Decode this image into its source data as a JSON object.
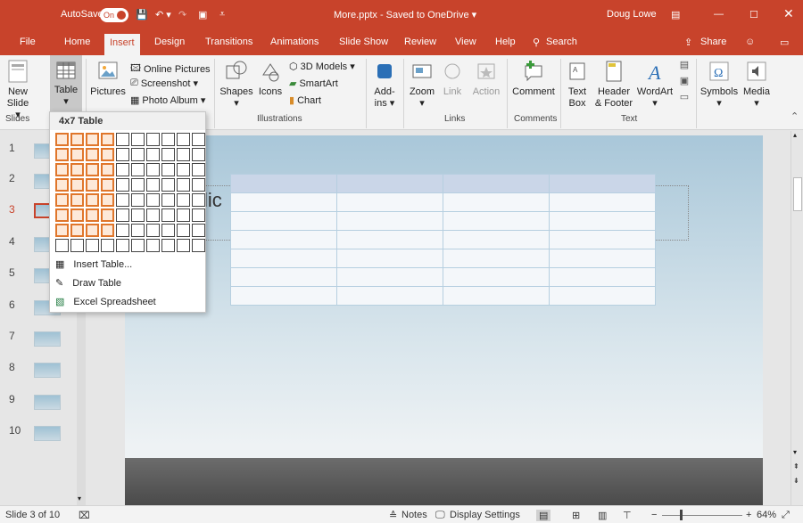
{
  "title_bar": {
    "autosave_label": "AutoSave",
    "autosave_state": "On",
    "document_title": "More.pptx - Saved to OneDrive ▾",
    "user_name": "Doug Lowe"
  },
  "tabs": [
    "File",
    "Home",
    "Insert",
    "Design",
    "Transitions",
    "Animations",
    "Slide Show",
    "Review",
    "View",
    "Help"
  ],
  "active_tab": "Insert",
  "search_label": "Search",
  "share_label": "Share",
  "ribbon": {
    "slides": {
      "new_slide": "New",
      "new_slide2": "Slide ▾",
      "group": "Slides"
    },
    "tables": {
      "table": "Table",
      "table_arrow": "▾"
    },
    "images": {
      "pictures": "Pictures",
      "online_pictures": "Online Pictures",
      "screenshot": "Screenshot ▾",
      "photo_album": "Photo Album ▾"
    },
    "illustrations": {
      "shapes": "Shapes",
      "icons": "Icons",
      "models": "3D Models ▾",
      "smartart": "SmartArt",
      "chart": "Chart",
      "group": "Illustrations"
    },
    "addins": {
      "label": "Add-",
      "label2": "ins ▾"
    },
    "links": {
      "zoom": "Zoom",
      "link": "Link",
      "action": "Action",
      "group": "Links"
    },
    "comments": {
      "comment": "Comment",
      "group": "Comments"
    },
    "text": {
      "textbox": "Text",
      "textbox2": "Box",
      "header": "Header",
      "header2": "& Footer",
      "wordart": "WordArt",
      "group": "Text"
    },
    "symbols": {
      "symbols": "Symbols",
      "media": "Media"
    }
  },
  "table_dropdown": {
    "header": "4x7 Table",
    "selected_cols": 4,
    "selected_rows": 7,
    "grid_cols": 10,
    "grid_rows": 8,
    "items": [
      {
        "label": "Insert Table...",
        "icon": "insert-table-icon"
      },
      {
        "label": "Draw Table",
        "icon": "draw-table-icon"
      },
      {
        "label": "Excel Spreadsheet",
        "icon": "excel-icon"
      }
    ]
  },
  "thumbnails": [
    "1",
    "2",
    "3",
    "4",
    "5",
    "6",
    "7",
    "8",
    "9",
    "10"
  ],
  "selected_slide": "3",
  "slide": {
    "title_fragment": "lic"
  },
  "status": {
    "slide_counter": "Slide 3 of 10",
    "notes": "Notes",
    "display_settings": "Display Settings",
    "zoom": "64%"
  },
  "colors": {
    "accent": "#c8432b",
    "selection": "#e0762b"
  }
}
